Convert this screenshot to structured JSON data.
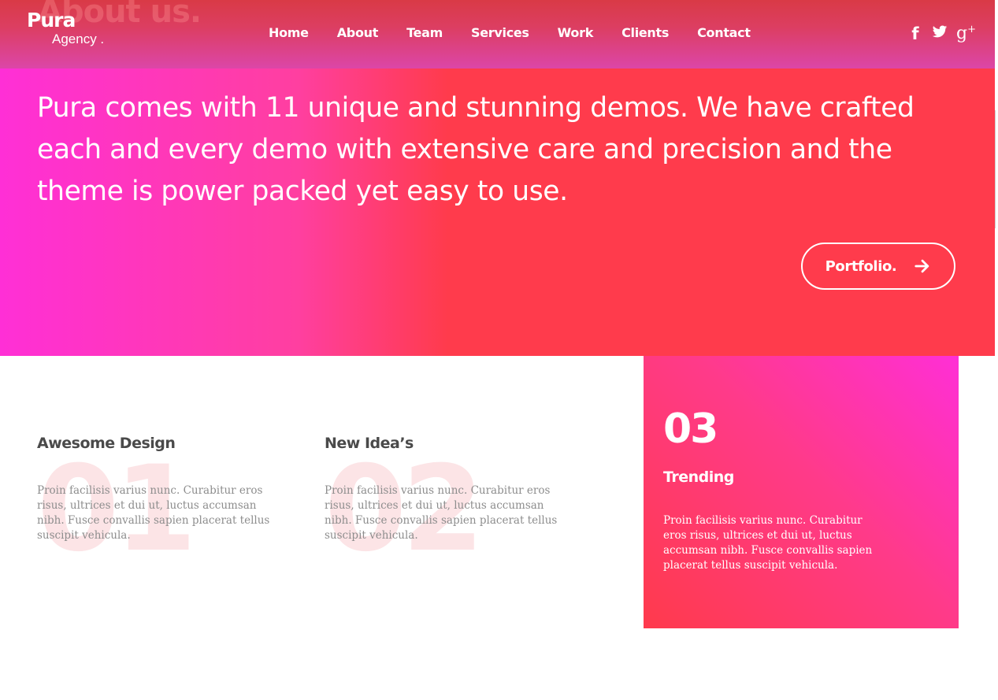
{
  "header": {
    "ghost_title": "About us.",
    "logo_name": "Pura",
    "logo_sub": "Agency .",
    "nav": [
      "Home",
      "About",
      "Team",
      "Services",
      "Work",
      "Clients",
      "Contact"
    ],
    "social_icons": [
      "facebook-icon",
      "twitter-icon",
      "google-plus-icon"
    ],
    "gplus_text": "g",
    "gplus_sup": "+"
  },
  "hero": {
    "lead": "Pura comes with 11 unique and stunning demos. We have crafted each and every demo with extensive care and precision and the theme is power packed yet easy to use.",
    "button_label": "Portfolio.",
    "button_icon": "arrow-right-icon"
  },
  "features": [
    {
      "number": "01",
      "title": "Awesome Design",
      "text": "Proin facilisis varius nunc. Curabitur eros risus, ultrices et dui ut, luctus accumsan nibh. Fusce convallis sapien placerat tellus suscipit vehicula."
    },
    {
      "number": "02",
      "title": "New Idea’s",
      "text": "Proin facilisis varius nunc. Curabitur eros risus, ultrices et dui ut, luctus accumsan nibh. Fusce convallis sapien placerat tellus suscipit vehicula."
    },
    {
      "number": "03",
      "title": "Trending",
      "text": "Proin facilisis varius nunc. Curabitur eros risus, ultrices et dui ut, luctus accumsan nibh. Fusce convallis sapien placerat tellus suscipit vehicula."
    }
  ],
  "colors": {
    "pink": "#ff2fd6",
    "red": "#ff3b4c",
    "text_dark": "#4a4a4a",
    "text_muted": "#8d8d8d",
    "ghost_number": "#fce4e6"
  }
}
